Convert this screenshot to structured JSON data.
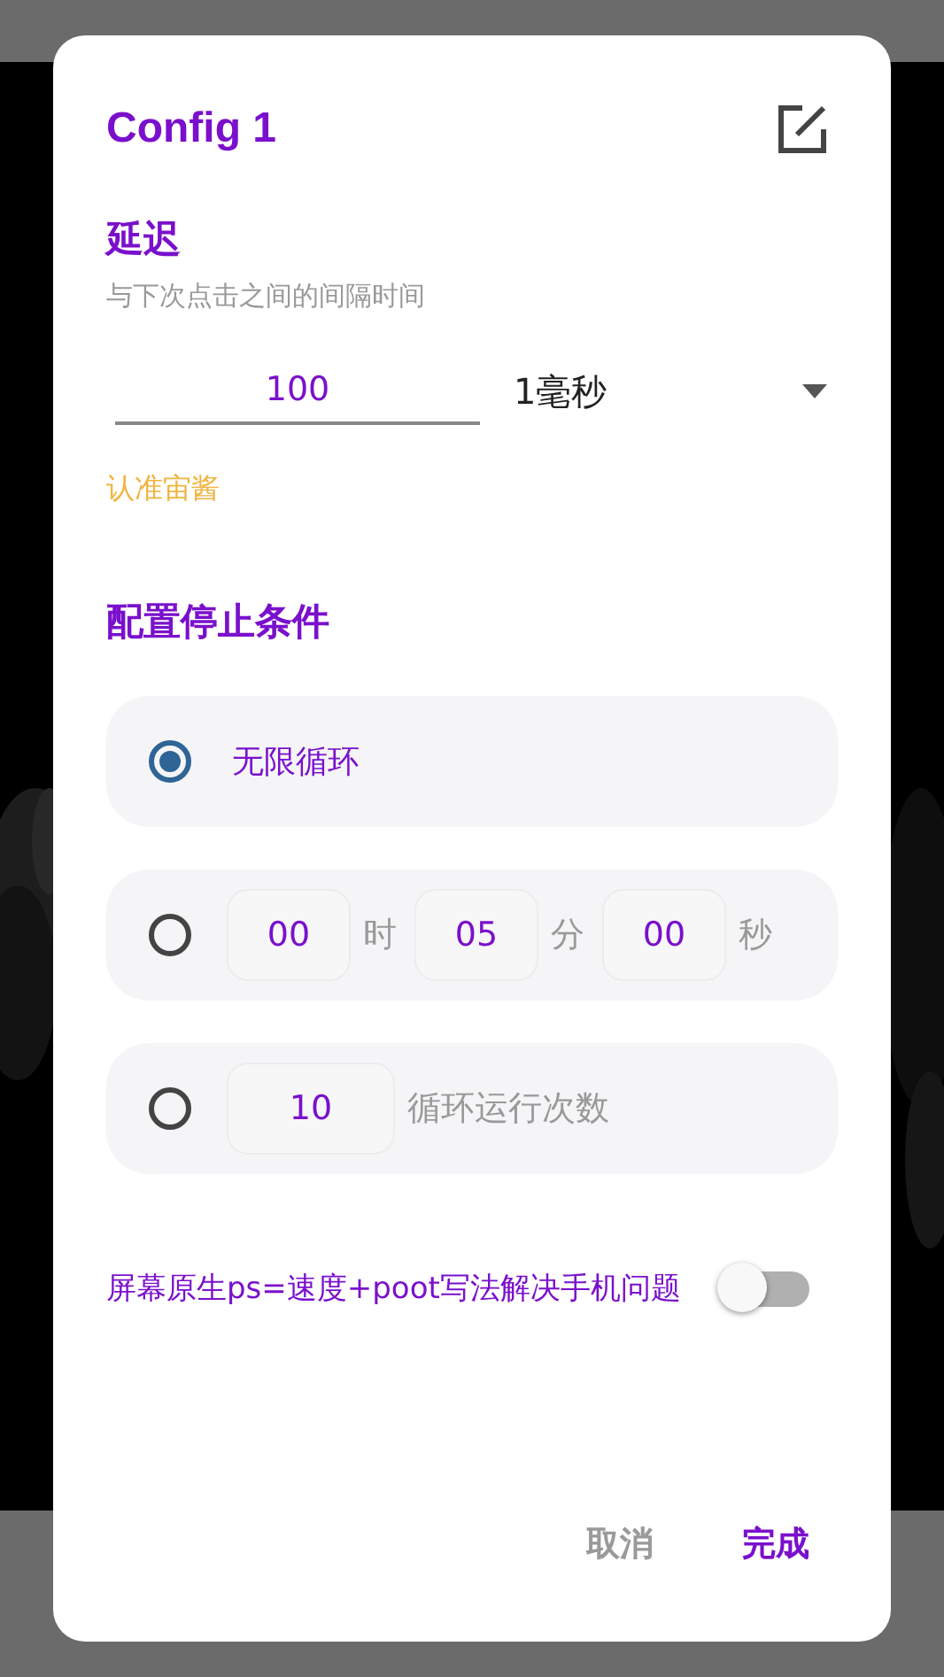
{
  "dialog": {
    "title": "Config 1",
    "delay": {
      "heading": "延迟",
      "hint": "与下次点击之间的间隔时间",
      "value": "100",
      "unit": "1毫秒",
      "note": "认准宙酱"
    },
    "stop": {
      "heading": "配置停止条件",
      "options": [
        {
          "kind": "label",
          "selected": true,
          "label": "无限循环"
        },
        {
          "kind": "fields",
          "selected": false,
          "fields": [
            {
              "value": "00",
              "unit": "时"
            },
            {
              "value": "05",
              "unit": "分"
            },
            {
              "value": "00",
              "unit": "秒"
            }
          ]
        },
        {
          "kind": "fields",
          "selected": false,
          "fields": [
            {
              "value": "10",
              "unit": "循环运行次数"
            }
          ]
        }
      ]
    },
    "toggle": {
      "label": "屏幕原生ps=速度+poot写法解决手机问题",
      "on": false
    },
    "buttons": [
      {
        "kind": "cancel",
        "label": "取消"
      },
      {
        "kind": "confirm",
        "label": "完成"
      }
    ]
  }
}
